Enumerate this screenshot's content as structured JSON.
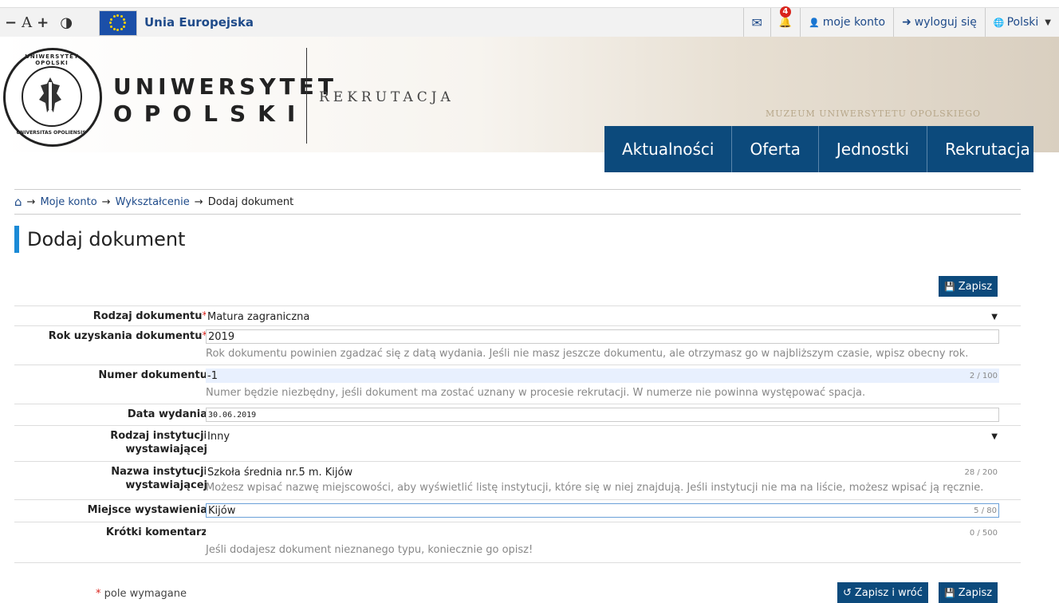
{
  "topbar": {
    "a11y": {
      "minus": "−",
      "a": "A",
      "plus": "+",
      "contrast": "◑"
    },
    "eu_label": "Unia Europejska",
    "mail_icon": "✉",
    "bell_icon": "🔔",
    "notifications_count": "4",
    "account_icon": "👤",
    "account": "moje konto",
    "logout_icon": "➜",
    "logout": "wyloguj się",
    "lang_icon": "🌐",
    "language": "Polski",
    "lang_arrow": "▼"
  },
  "header": {
    "uni_line1": "UNIWERSYTET",
    "uni_line2": "OPOLSKI",
    "subtitle": "REKRUTACJA",
    "seal_top": "UNIWERSYTET OPOLSKI",
    "seal_bottom": "UNIVERSITAS OPOLIENSIS",
    "museum": "MUZEUM UNIWERSYTETU OPOLSKIEGO"
  },
  "mainnav": [
    "Aktualności",
    "Oferta",
    "Jednostki",
    "Rekrutacja"
  ],
  "breadcrumb": {
    "home_icon": "⌂",
    "arrow": "→",
    "items": [
      "Moje konto",
      "Wykształcenie"
    ],
    "current": "Dodaj dokument"
  },
  "page_title": "Dodaj dokument",
  "buttons": {
    "save": "Zapisz",
    "save_return": "Zapisz i wróć",
    "save_icon": "💾",
    "return_icon": "↺"
  },
  "form": {
    "required_mark": "*",
    "doc_type": {
      "label": "Rodzaj dokumentu",
      "value": "Matura zagraniczna"
    },
    "doc_year": {
      "label": "Rok uzyskania dokumentu",
      "value": "2019",
      "hint": "Rok dokumentu powinien zgadzać się z datą wydania. Jeśli nie masz jeszcze dokumentu, ale otrzymasz go w najbliższym czasie, wpisz obecny rok."
    },
    "doc_number": {
      "label": "Numer dokumentu",
      "value": "-1",
      "counter": "2 / 100",
      "hint": "Numer będzie niezbędny, jeśli dokument ma zostać uznany w procesie rekrutacji. W numerze nie powinna występować spacja."
    },
    "issue_date": {
      "label": "Data wydania",
      "value": "30.06.2019"
    },
    "inst_type": {
      "label1": "Rodzaj instytucji",
      "label2": "wystawiającej",
      "value": "Inny"
    },
    "inst_name": {
      "label1": "Nazwa instytucji",
      "label2": "wystawiającej",
      "value": "Szkoła średnia nr.5 m. Kijów",
      "counter": "28 / 200",
      "hint": "Możesz wpisać nazwę miejscowości, aby wyświetlić listę instytucji, które się w niej znajdują. Jeśli instytucji nie ma na liście, możesz wpisać ją ręcznie."
    },
    "place": {
      "label": "Miejsce wystawienia",
      "value": "Kijów",
      "counter": "5 / 80"
    },
    "comment": {
      "label": "Krótki komentarz",
      "value": "",
      "counter": "0 / 500",
      "hint": "Jeśli dodajesz dokument nieznanego typu, koniecznie go opisz!"
    },
    "select_arrow": "▼"
  },
  "required_note": "pole wymagane"
}
